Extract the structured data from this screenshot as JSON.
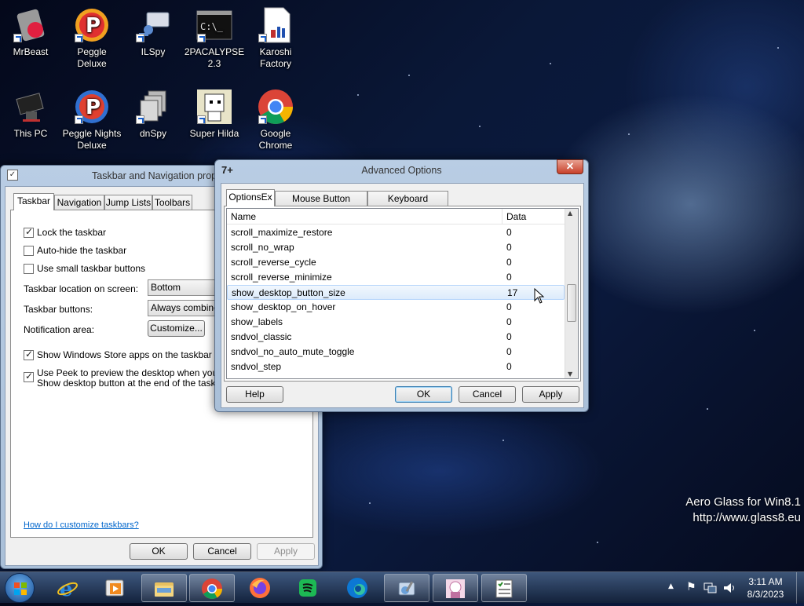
{
  "desktop": {
    "icons": [
      {
        "label": "MrBeast"
      },
      {
        "label": "Peggle Deluxe"
      },
      {
        "label": "ILSpy"
      },
      {
        "label": "2PACALYPSE 2.3"
      },
      {
        "label": "Karoshi Factory"
      },
      {
        "label": "This PC"
      },
      {
        "label": "Peggle Nights Deluxe"
      },
      {
        "label": "dnSpy"
      },
      {
        "label": "Super Hilda"
      },
      {
        "label": "Google Chrome"
      }
    ],
    "watermark": {
      "line1": "Aero Glass for Win8.1",
      "line2": "http://www.glass8.eu"
    }
  },
  "taskbar_props": {
    "title": "Taskbar and Navigation prope",
    "tabs": [
      "Taskbar",
      "Navigation",
      "Jump Lists",
      "Toolbars"
    ],
    "lock_label": "Lock the taskbar",
    "autohide_label": "Auto-hide the taskbar",
    "small_buttons_label": "Use small taskbar buttons",
    "location_label": "Taskbar location on screen:",
    "location_value": "Bottom",
    "buttons_label": "Taskbar buttons:",
    "buttons_value": "Always combine,",
    "notification_label": "Notification area:",
    "customize_label": "Customize...",
    "store_apps_label": "Show Windows Store apps on the taskbar",
    "peek_line1": "Use Peek to preview the desktop when you mov",
    "peek_line2": "Show desktop button at the end of the taskbar",
    "help_link": "How do I customize taskbars?",
    "ok_label": "OK",
    "cancel_label": "Cancel",
    "apply_label": "Apply"
  },
  "advanced": {
    "title": "Advanced Options",
    "tabs": [
      "OptionsEx",
      "Mouse Button Control",
      "Keyboard Shortcuts"
    ],
    "columns": [
      "Name",
      "Data"
    ],
    "rows": [
      {
        "name": "scroll_maximize_restore",
        "data": "0"
      },
      {
        "name": "scroll_no_wrap",
        "data": "0"
      },
      {
        "name": "scroll_reverse_cycle",
        "data": "0"
      },
      {
        "name": "scroll_reverse_minimize",
        "data": "0"
      },
      {
        "name": "show_desktop_button_size",
        "data": "17"
      },
      {
        "name": "show_desktop_on_hover",
        "data": "0"
      },
      {
        "name": "show_labels",
        "data": "0"
      },
      {
        "name": "sndvol_classic",
        "data": "0"
      },
      {
        "name": "sndvol_no_auto_mute_toggle",
        "data": "0"
      },
      {
        "name": "sndvol_step",
        "data": "0"
      }
    ],
    "help_label": "Help",
    "ok_label": "OK",
    "cancel_label": "Cancel",
    "apply_label": "Apply"
  },
  "tray": {
    "time": "3:11 AM",
    "date": "8/3/2023"
  },
  "colors": {
    "accent": "#3c7fb1",
    "selection": "#dcebfc",
    "link": "#0066cc"
  }
}
